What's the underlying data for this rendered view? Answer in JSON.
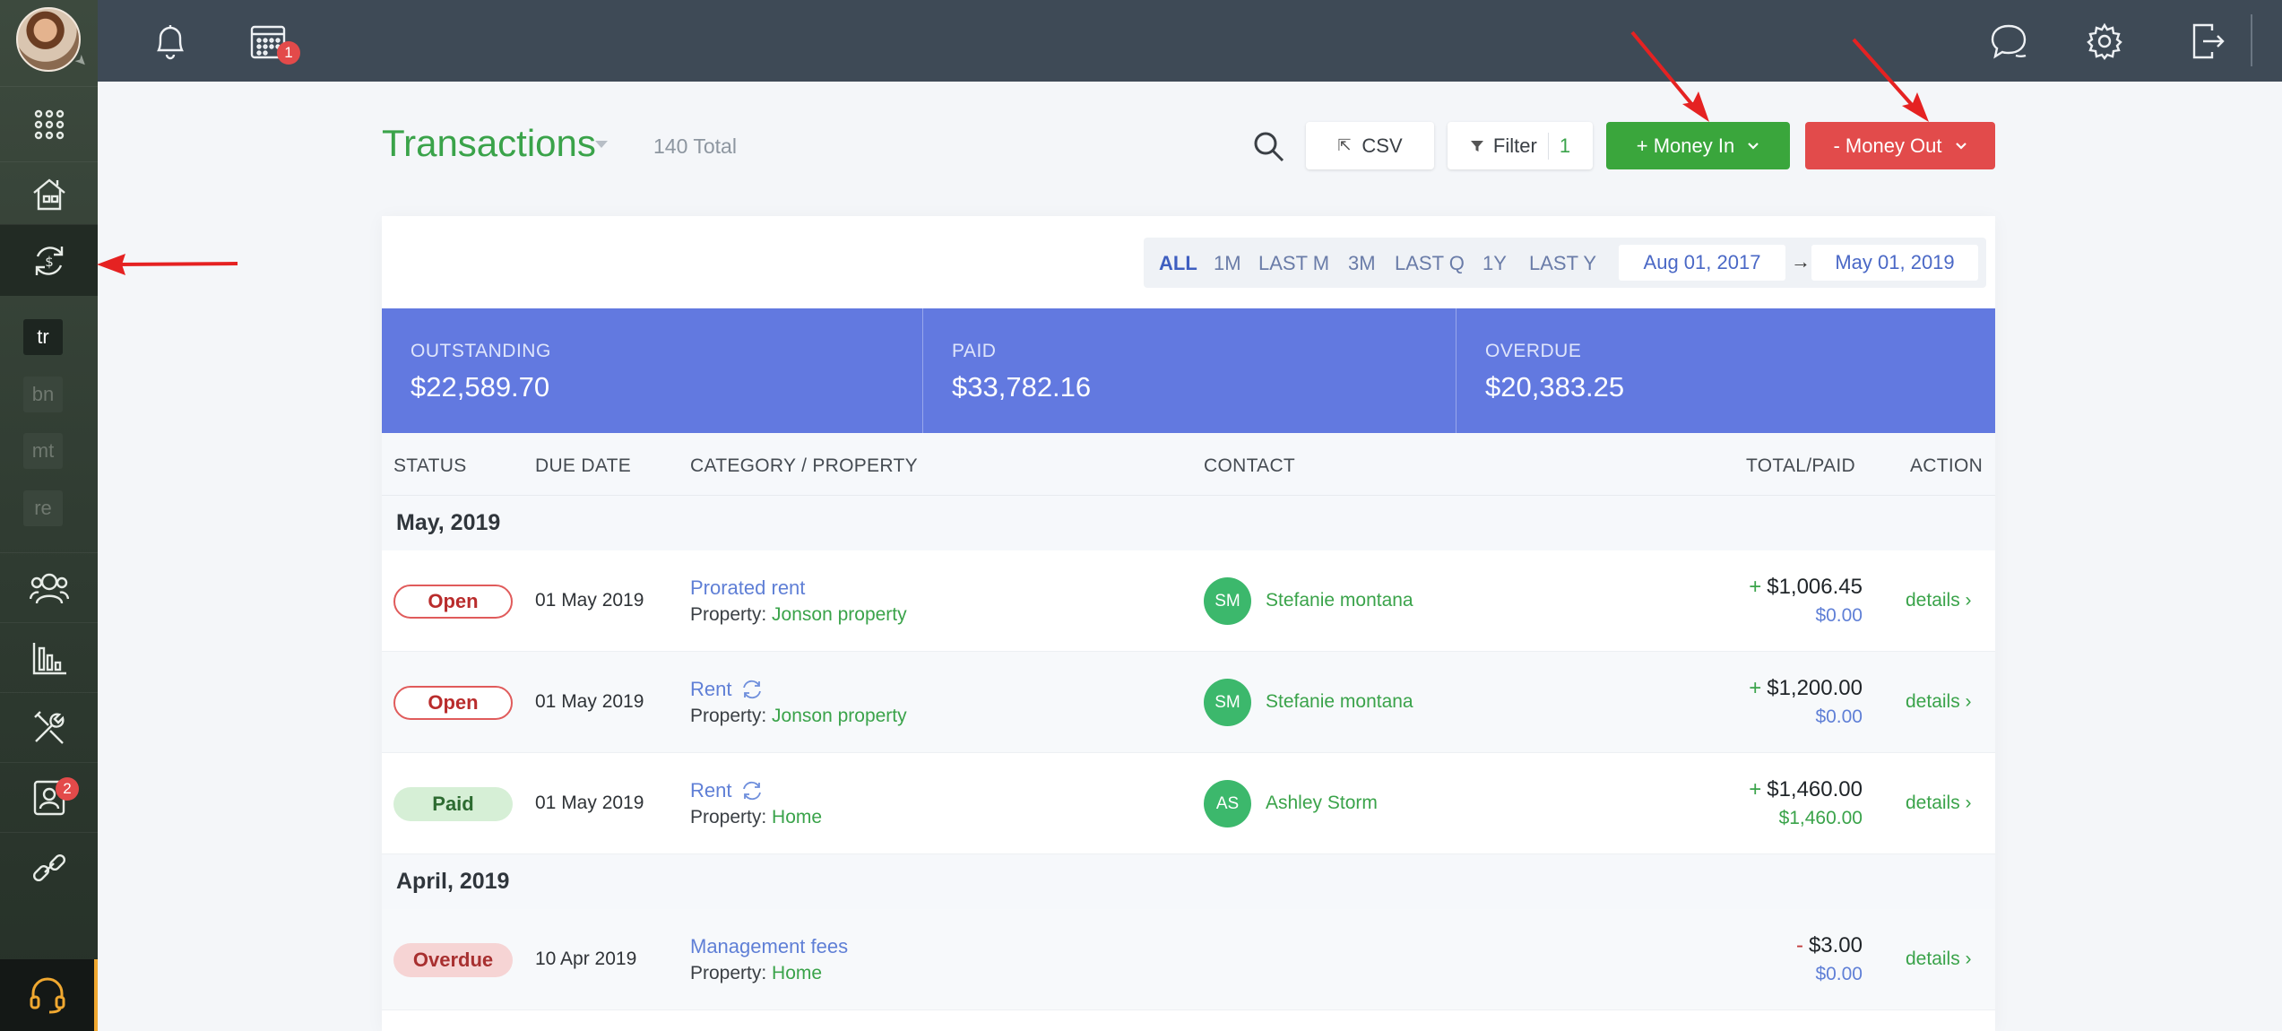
{
  "sidebar": {
    "user_avatar": "user-photo",
    "mini_items": [
      "tr",
      "bn",
      "mt",
      "re"
    ],
    "tenants_badge": "2"
  },
  "topbar": {
    "calendar_badge": "1"
  },
  "header": {
    "title": "Transactions",
    "total": "140 Total",
    "csv_label": "CSV",
    "filter_label": "Filter",
    "filter_count": "1",
    "money_in_label": "+ Money In",
    "money_out_label": "- Money Out"
  },
  "range": {
    "options": [
      "ALL",
      "1M",
      "LAST M",
      "3M",
      "LAST Q",
      "1Y",
      "LAST Y"
    ],
    "selected": "ALL",
    "start_date": "Aug 01, 2017",
    "end_date": "May 01, 2019"
  },
  "summary": {
    "outstanding_label": "OUTSTANDING",
    "outstanding_value": "$22,589.70",
    "paid_label": "PAID",
    "paid_value": "$33,782.16",
    "overdue_label": "OVERDUE",
    "overdue_value": "$20,383.25"
  },
  "table": {
    "columns": {
      "status": "STATUS",
      "due_date": "DUE DATE",
      "category": "CATEGORY / PROPERTY",
      "contact": "CONTACT",
      "total": "TOTAL/PAID",
      "action": "ACTION"
    },
    "property_prefix": "Property:",
    "details_label": "details ›",
    "groups": [
      {
        "label": "May, 2019"
      },
      {
        "label": "April, 2019"
      }
    ],
    "rows": [
      {
        "status": "Open",
        "due": "01 May 2019",
        "category": "Prorated rent",
        "property": "Jonson property",
        "initials": "SM",
        "contact": "Stefanie montana",
        "sign": "+",
        "total": "$1,006.45",
        "paid": "$0.00"
      },
      {
        "status": "Open",
        "due": "01 May 2019",
        "category": "Rent",
        "property": "Jonson property",
        "initials": "SM",
        "contact": "Stefanie montana",
        "sign": "+",
        "total": "$1,200.00",
        "paid": "$0.00"
      },
      {
        "status": "Paid",
        "due": "01 May 2019",
        "category": "Rent",
        "property": "Home",
        "initials": "AS",
        "contact": "Ashley Storm",
        "sign": "+",
        "total": "$1,460.00",
        "paid": "$1,460.00"
      },
      {
        "status": "Overdue",
        "due": "10 Apr 2019",
        "category": "Management fees",
        "property": "Home",
        "initials": "",
        "contact": "",
        "sign": "-",
        "total": "$3.00",
        "paid": "$0.00"
      }
    ]
  },
  "colors": {
    "accent_green": "#3aa34a",
    "money_out_red": "#e24b4b",
    "summary_blue": "#6279e0",
    "sidebar_dark": "#2f3b31",
    "topbar": "#3e4a56"
  }
}
